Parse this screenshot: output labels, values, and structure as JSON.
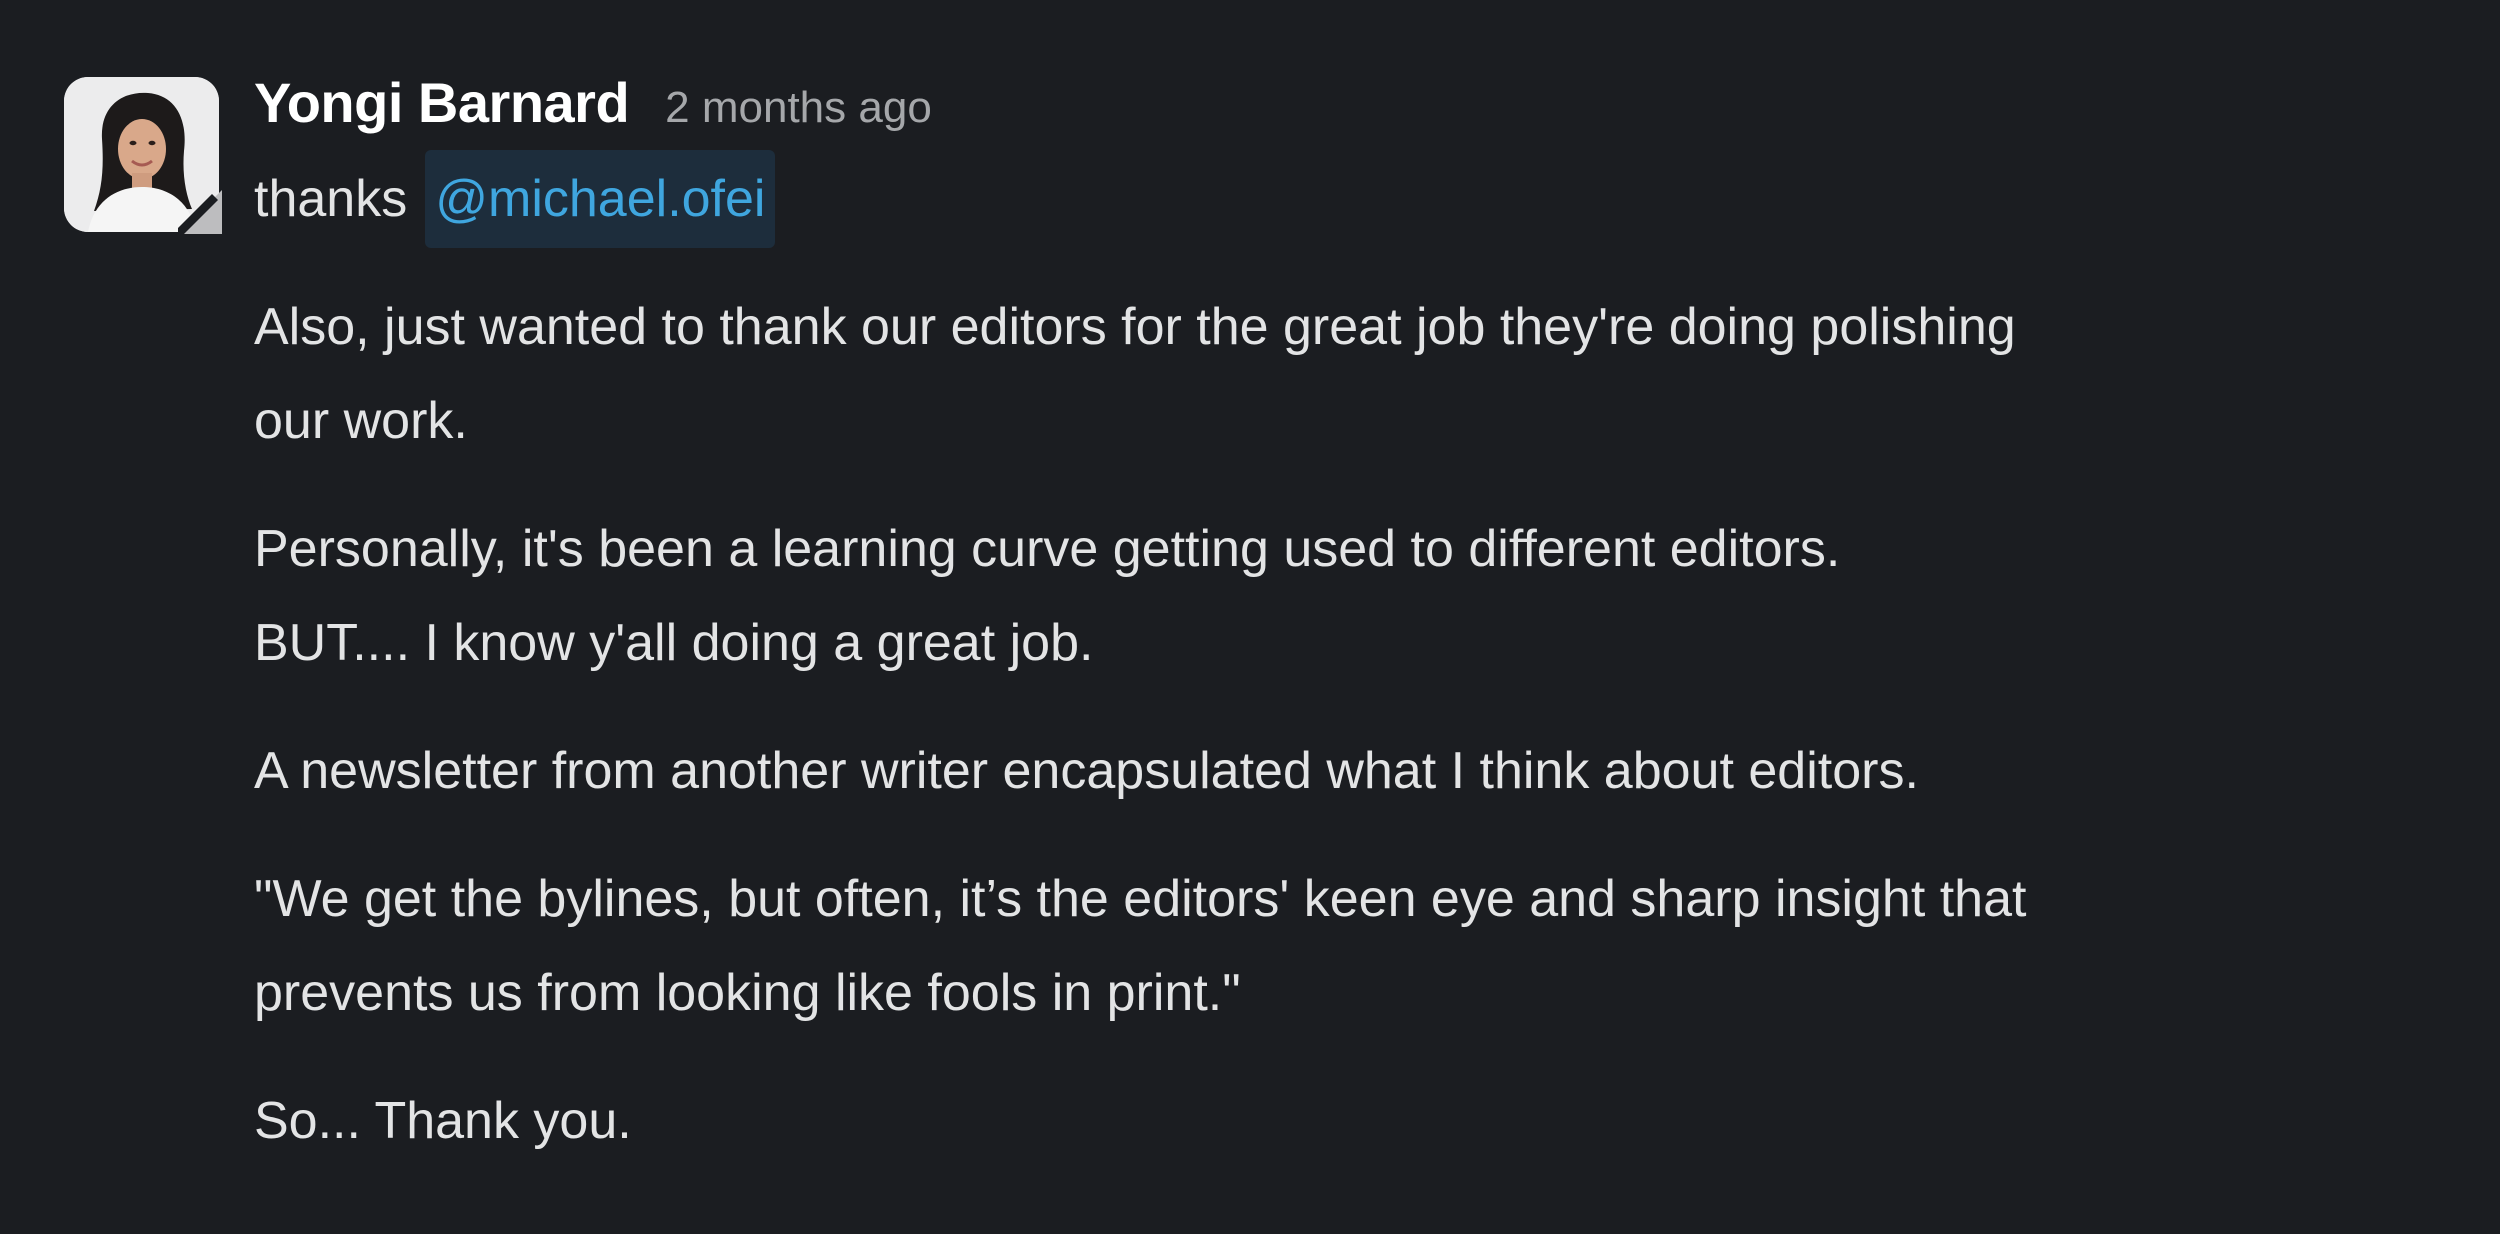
{
  "message": {
    "author": "Yongi Barnard",
    "timestamp": "2 months ago",
    "first_line_text": "thanks",
    "mention": "@michael.ofei",
    "paragraphs": [
      {
        "lines": [
          "Also, just wanted to thank our editors for the great job they're doing polishing",
          "our work."
        ]
      },
      {
        "lines": [
          "Personally, it's been a learning curve getting used to different editors.",
          "BUT.... I know y'all doing a great job."
        ]
      },
      {
        "lines": [
          "A newsletter from another writer encapsulated what  I think about editors."
        ]
      },
      {
        "lines": [
          "\"We get the bylines, but often, it’s the editors' keen eye and sharp insight that",
          "prevents us from looking like fools in print.\""
        ]
      },
      {
        "lines": [
          "So... Thank you."
        ]
      }
    ]
  },
  "colors": {
    "background": "#1b1d21",
    "author": "#ffffff",
    "timestamp": "#a5a7aa",
    "body_text": "#e3e4e5",
    "mention_text": "#3fa6df",
    "mention_bg": "#1d2d3c"
  },
  "icons": {
    "avatar": "user-avatar-photo",
    "status": "status-corner-icon"
  }
}
